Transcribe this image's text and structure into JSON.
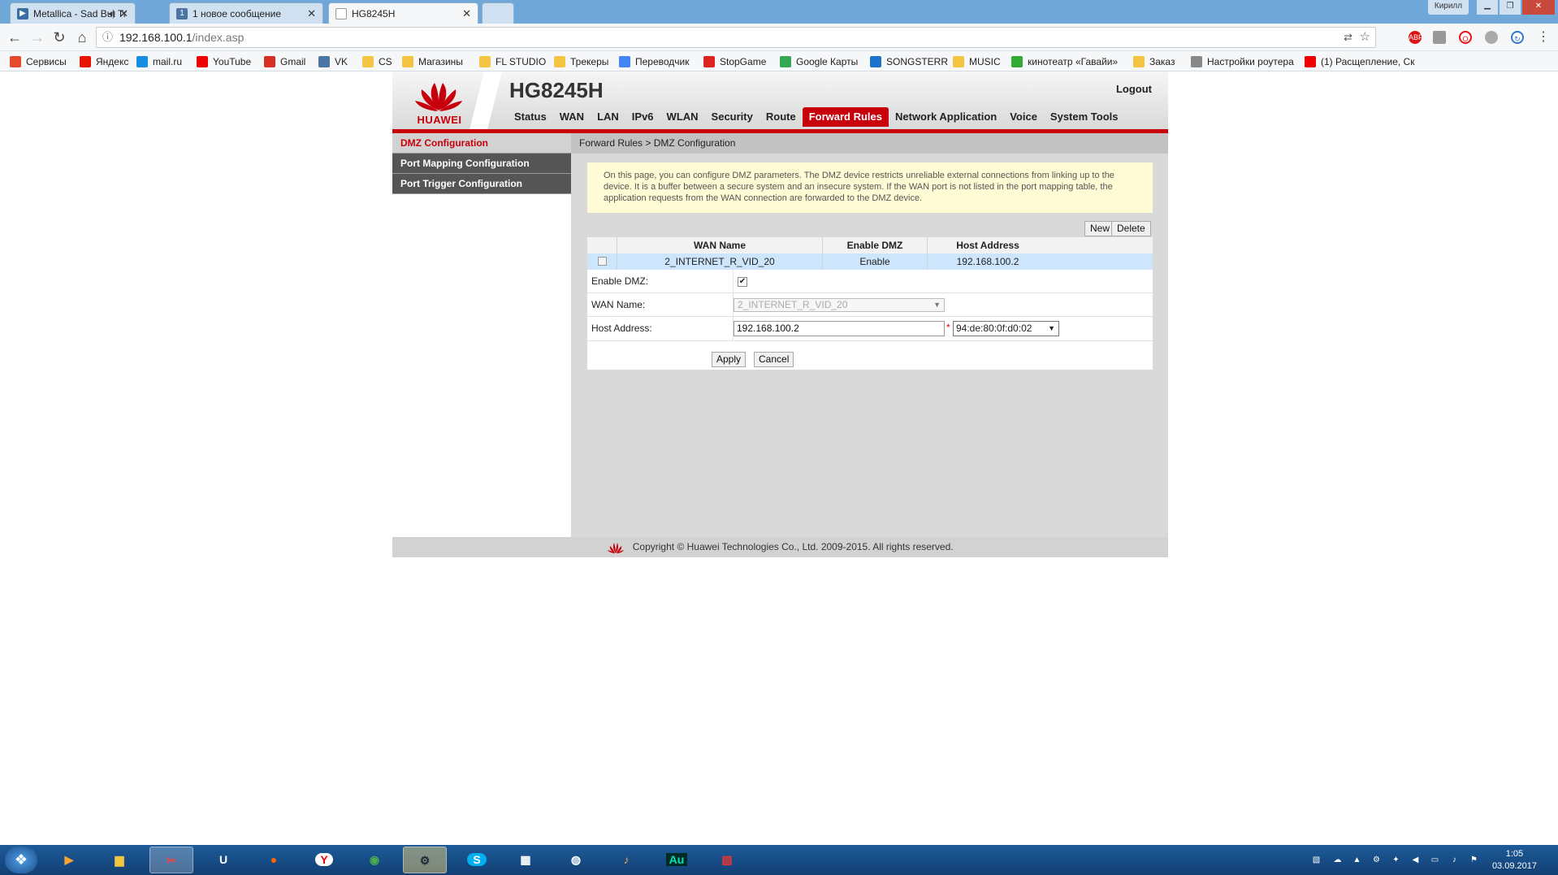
{
  "browser": {
    "tabs": [
      {
        "title": "Metallica - Sad But Tr",
        "icon": "video-icon"
      },
      {
        "title": "1 новое сообщение",
        "icon": "vk-message-icon"
      },
      {
        "title": "HG8245H",
        "icon": "page-icon"
      }
    ],
    "window_label": "Кирилл",
    "url_host": "192.168.100.1",
    "url_path": "/index.asp"
  },
  "bookmarks": [
    {
      "label": "Сервисы",
      "icon": "apps-grid-icon",
      "color": "#e34a2c"
    },
    {
      "label": "Яндекс",
      "icon": "yandex-icon",
      "color": "#e61400"
    },
    {
      "label": "mail.ru",
      "icon": "mailru-icon",
      "color": "#168de2"
    },
    {
      "label": "YouTube",
      "icon": "youtube-icon",
      "color": "#e00"
    },
    {
      "label": "Gmail",
      "icon": "gmail-icon",
      "color": "#d93025"
    },
    {
      "label": "VK",
      "icon": "vk-icon",
      "color": "#4c75a3"
    },
    {
      "label": "CS",
      "icon": "folder-icon",
      "color": "#f4c542"
    },
    {
      "label": "Магазины",
      "icon": "folder-icon",
      "color": "#f4c542"
    },
    {
      "label": "FL STUDIO",
      "icon": "folder-icon",
      "color": "#f4c542"
    },
    {
      "label": "Трекеры",
      "icon": "folder-icon",
      "color": "#f4c542"
    },
    {
      "label": "Переводчик",
      "icon": "translate-icon",
      "color": "#4285f4"
    },
    {
      "label": "StopGame",
      "icon": "stopgame-icon",
      "color": "#d22"
    },
    {
      "label": "Google Карты",
      "icon": "maps-icon",
      "color": "#34a853"
    },
    {
      "label": "SONGSTERR",
      "icon": "songsterr-icon",
      "color": "#1a73c8"
    },
    {
      "label": "MUSIC",
      "icon": "folder-icon",
      "color": "#f4c542"
    },
    {
      "label": "кинотеатр «Гавайи»",
      "icon": "cinema-icon",
      "color": "#3a3"
    },
    {
      "label": "Заказ",
      "icon": "folder-icon",
      "color": "#f4c542"
    },
    {
      "label": "Настройки роутера",
      "icon": "page-icon",
      "color": "#888"
    },
    {
      "label": "(1) Расщепление, Ск",
      "icon": "youtube-icon",
      "color": "#e00"
    }
  ],
  "router": {
    "brand": "HUAWEI",
    "model": "HG8245H",
    "logout": "Logout",
    "nav": [
      "Status",
      "WAN",
      "LAN",
      "IPv6",
      "WLAN",
      "Security",
      "Route",
      "Forward Rules",
      "Network Application",
      "Voice",
      "System Tools"
    ],
    "nav_active": "Forward Rules",
    "sidebar": [
      "DMZ Configuration",
      "Port Mapping Configuration",
      "Port Trigger Configuration"
    ],
    "breadcrumb": "Forward Rules > DMZ Configuration",
    "note": "On this page, you can configure DMZ parameters. The DMZ device restricts unreliable external connections from linking up to the device. It is a buffer between a secure system and an insecure system. If the WAN port is not listed in the port mapping table, the application requests from the WAN connection are forwarded to the DMZ device.",
    "buttons": {
      "new": "New",
      "delete": "Delete",
      "apply": "Apply",
      "cancel": "Cancel"
    },
    "table": {
      "headers": [
        "WAN Name",
        "Enable DMZ",
        "Host Address"
      ],
      "rows": [
        [
          "2_INTERNET_R_VID_20",
          "Enable",
          "192.168.100.2"
        ]
      ]
    },
    "form": {
      "enable_label": "Enable DMZ:",
      "enable_checked": true,
      "wan_label": "WAN Name:",
      "wan_value": "2_INTERNET_R_VID_20",
      "host_label": "Host Address:",
      "host_value": "192.168.100.2",
      "mac_value": "94:de:80:0f:d0:02",
      "required_mark": "*"
    },
    "footer": "Copyright © Huawei Technologies Co., Ltd. 2009-2015. All rights reserved.",
    "accent_color": "#c7000b"
  },
  "taskbar": {
    "time": "1:05",
    "date": "03.09.2017"
  }
}
